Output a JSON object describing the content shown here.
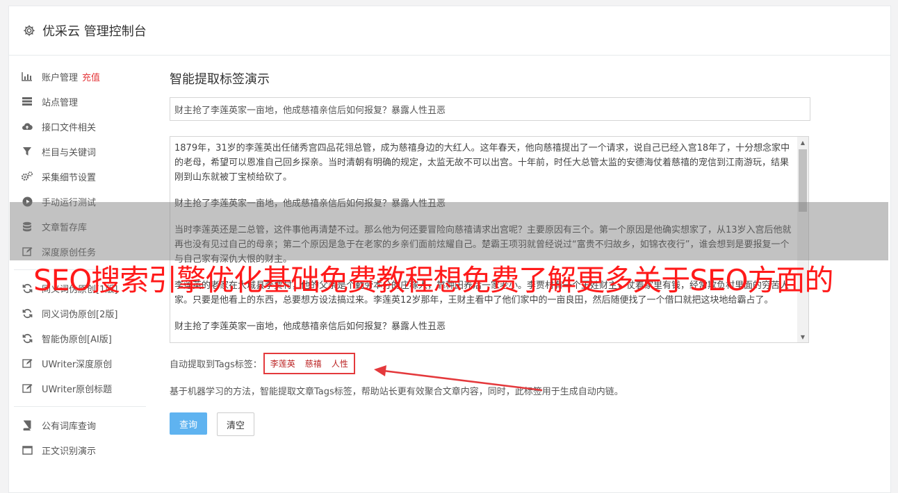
{
  "header": {
    "title": "优采云 管理控制台",
    "icon": "gear-icon"
  },
  "sidebar": {
    "group1": [
      {
        "label": "账户管理",
        "highlight": "充值",
        "icon": "bar-chart-icon"
      },
      {
        "label": "站点管理",
        "icon": "server-icon"
      },
      {
        "label": "接口文件相关",
        "icon": "cloud-upload-icon"
      },
      {
        "label": "栏目与关键词",
        "icon": "filter-icon"
      },
      {
        "label": "采集细节设置",
        "icon": "cogs-icon"
      },
      {
        "label": "手动运行测试",
        "icon": "play-icon"
      },
      {
        "label": "文章暂存库",
        "icon": "database-icon"
      },
      {
        "label": "深度原创任务",
        "icon": "edit-icon"
      }
    ],
    "group2": [
      {
        "label": "同义词伪原创[1版]",
        "icon": "refresh-icon"
      },
      {
        "label": "同义词伪原创[2版]",
        "icon": "refresh-icon"
      },
      {
        "label": "智能伪原创[AI版]",
        "icon": "refresh-icon"
      },
      {
        "label": "UWriter深度原创",
        "icon": "edit-icon"
      },
      {
        "label": "UWriter原创标题",
        "icon": "edit-icon"
      }
    ],
    "group3": [
      {
        "label": "公有词库查询",
        "icon": "book-icon"
      },
      {
        "label": "正文识别演示",
        "icon": "window-icon"
      }
    ]
  },
  "main": {
    "page_title": "智能提取标签演示",
    "title_value": "财主抢了李莲英家一亩地，他成慈禧亲信后如何报复？暴露人性丑恶",
    "content_paragraphs": [
      "1879年，31岁的李莲英出任储秀宫四品花翎总管，成为慈禧身边的大红人。这年春天，他向慈禧提出了一个请求，说自己已经入宫18年了，十分想念家中的老母，希望可以恩准自己回乡探亲。当时清朝有明确的规定，太监无故不可以出宫。十年前，时任大总管太监的安德海仗着慈禧的宠信到江南游玩，结果刚到山东就被丁宝桢给砍了。",
      "财主抢了李莲英家一亩地，他成慈禧亲信后如何报复？暴露人性丑恶",
      "当时李莲英还是二总管，这件事他再清楚不过。那么他为何还要冒险向慈禧请求出宫呢？主要原因有三个。第一个原因是他确实想家了，从13岁入宫后他就再也没有见过自己的母亲；第二个原因是急于在老家的乡亲们面前炫耀自己。楚霸王项羽就曾经说过“富贵不归故乡，如锦衣夜行”，谁会想到是要报复一个与自己家有深仇大恨的财主。",
      "李莲英的老家在大城县李贾村，他的父亲是个勤劳本分的庄稼人，靠种田养活一家老小。李贾村有一个王姓财主，仗着家里有钱，经常欺负村里面的穷苦人家。只要是他看上的东西，总要想方设法搞过来。李莲英12岁那年，王财主看中了他们家中的一亩良田，然后随便找了一个借口就把这块地给霸占了。",
      "财主抢了李莲英家一亩地，他成慈禧亲信后如何报复？暴露人性丑恶"
    ],
    "tags_label": "自动提取到Tags标签：",
    "tags": [
      "李莲英",
      "慈禧",
      "人性"
    ],
    "description": "基于机器学习的方法，智能提取文章Tags标签，帮助站长更有效聚合文章内容，同时，此标签用于生成自动内链。",
    "query_button": "查询",
    "clear_button": "清空"
  },
  "overlay": {
    "text": "SEO搜索引擎优化基础免费教程想免费了解更多关于SEO方面的"
  },
  "colors": {
    "accent": "#5fb3f0",
    "highlight": "#e4393c",
    "overlay_text": "#ff1a1a"
  }
}
